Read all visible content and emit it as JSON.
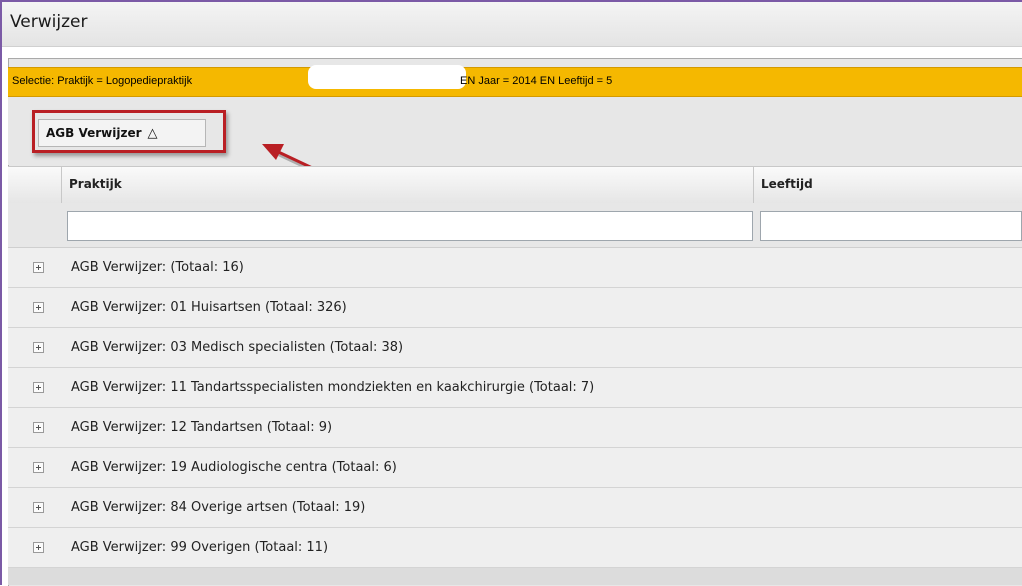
{
  "window": {
    "title": "Verwijzer"
  },
  "selection": {
    "prefix": "Selectie: Praktijk = Logopediepraktijk",
    "suffix": "EN Jaar = 2014 EN Leeftijd = 5"
  },
  "grouping": {
    "chip_label": "AGB Verwijzer",
    "sort_symbol": "△"
  },
  "columns": {
    "praktijk": "Praktijk",
    "leeftijd": "Leeftijd"
  },
  "filters": {
    "praktijk_value": "",
    "leeftijd_value": ""
  },
  "groups": [
    {
      "label": "AGB Verwijzer: (Totaal: 16)"
    },
    {
      "label": "AGB Verwijzer: 01 Huisartsen (Totaal: 326)"
    },
    {
      "label": "AGB Verwijzer: 03 Medisch specialisten (Totaal: 38)"
    },
    {
      "label": "AGB Verwijzer: 11 Tandartsspecialisten mondziekten en kaakchirurgie (Totaal: 7)"
    },
    {
      "label": "AGB Verwijzer: 12 Tandartsen (Totaal: 9)"
    },
    {
      "label": "AGB Verwijzer: 19 Audiologische centra (Totaal: 6)"
    },
    {
      "label": "AGB Verwijzer: 84 Overige artsen (Totaal: 19)"
    },
    {
      "label": "AGB Verwijzer: 99 Overigen (Totaal: 11)"
    }
  ],
  "colors": {
    "selection_bar": "#f5b800",
    "annotation_red": "#b91f24",
    "window_border": "#7b5aa6"
  },
  "icons": {
    "row_toggle": "plus-box-icon",
    "sort": "triangle-up-icon",
    "annotation": "red-arrow-icon"
  }
}
